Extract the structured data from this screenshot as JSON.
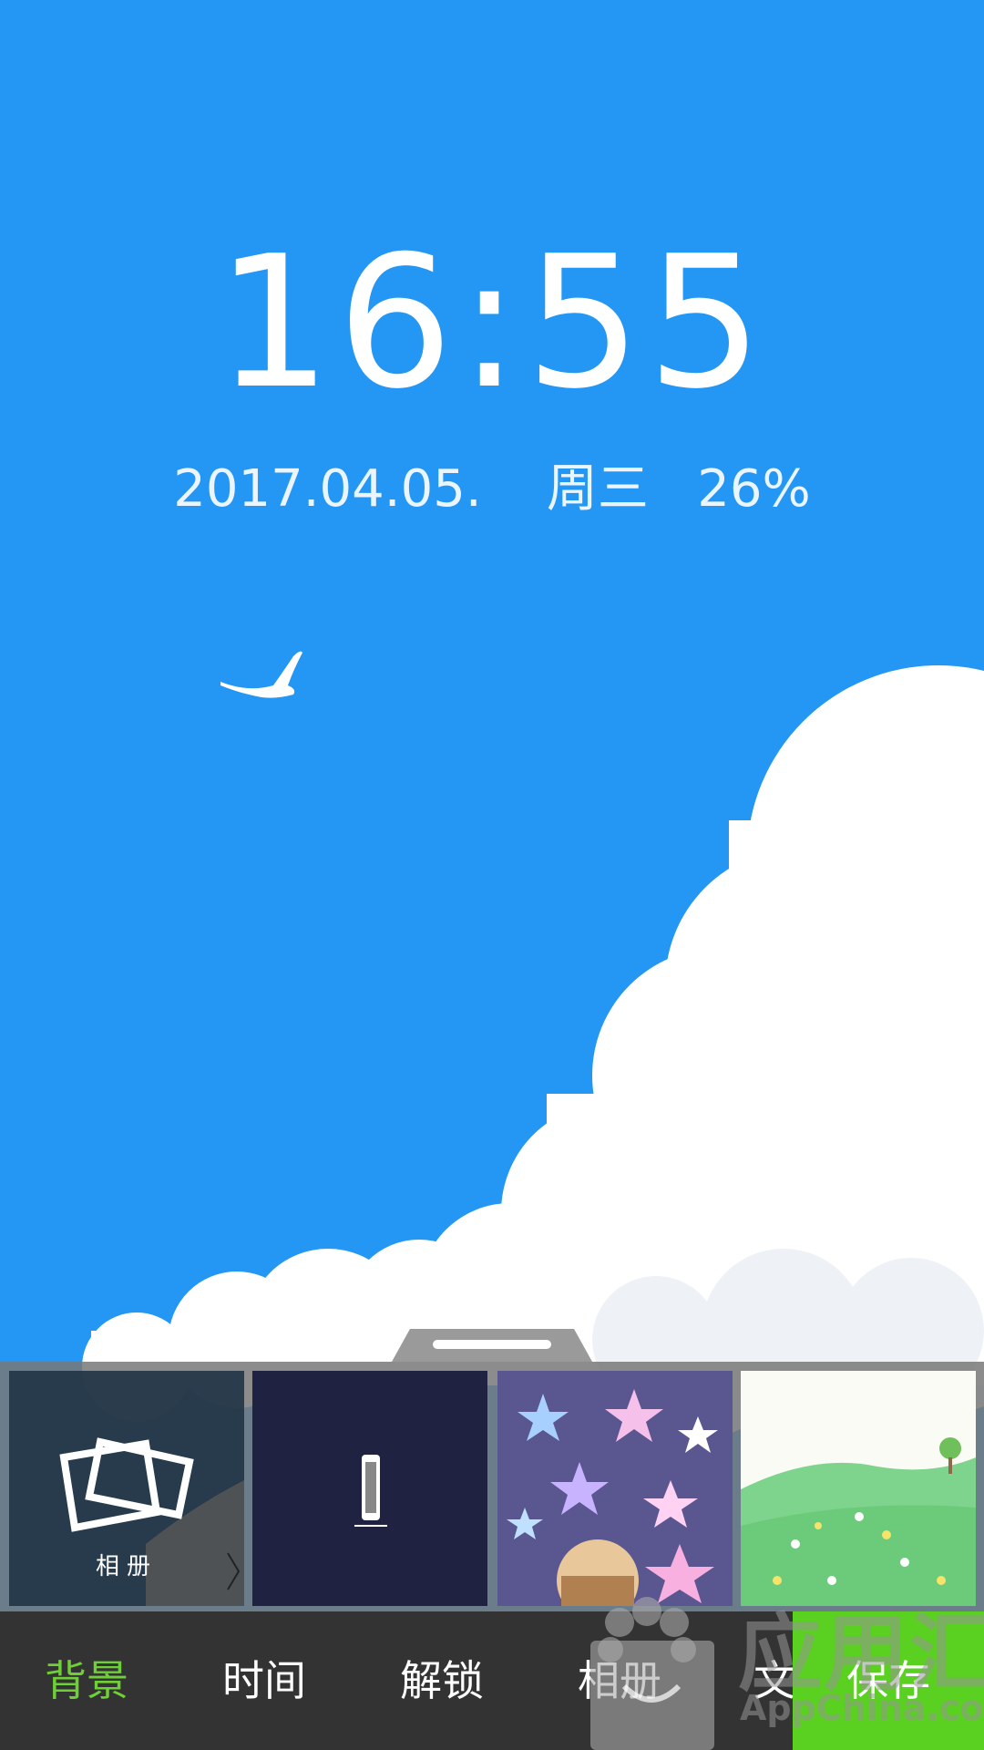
{
  "lockscreen": {
    "time": "16:55",
    "date": "2017.04.05.",
    "weekday": "周三",
    "battery": "26%"
  },
  "thumbnails": {
    "album_label": "相册"
  },
  "tabs": [
    {
      "label": "背景",
      "active": true
    },
    {
      "label": "时间",
      "active": false
    },
    {
      "label": "解锁",
      "active": false
    },
    {
      "label": "相册",
      "active": false
    },
    {
      "label": "文",
      "active": false
    }
  ],
  "save_label": "保存",
  "watermark": {
    "brand": "应用汇",
    "domain": "AppChina.com"
  },
  "colors": {
    "sky": "#2496f3",
    "active_tab": "#6fcf36",
    "save_button": "#5ad021",
    "tabbar": "#333333"
  }
}
